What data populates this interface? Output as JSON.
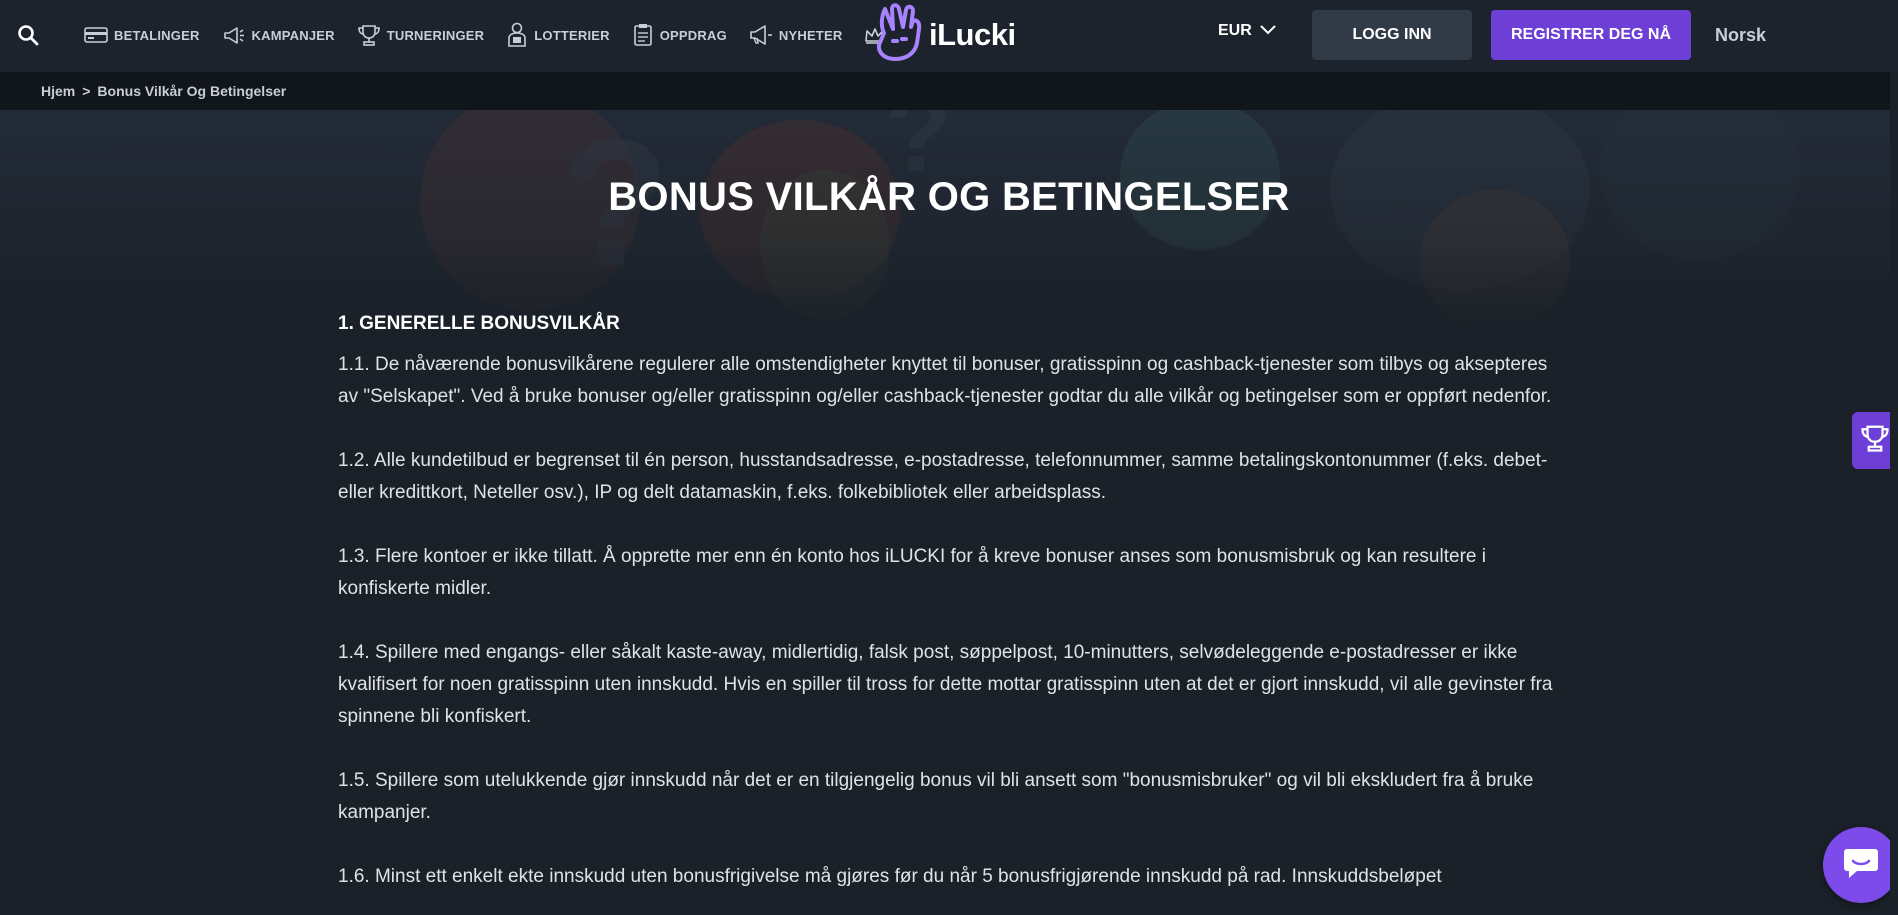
{
  "header": {
    "nav": [
      {
        "label": "BETALINGER",
        "icon": "card-icon"
      },
      {
        "label": "KAMPANJER",
        "icon": "megaphone-icon"
      },
      {
        "label": "TURNERINGER",
        "icon": "trophy-icon"
      },
      {
        "label": "LOTTERIER",
        "icon": "lottery-icon"
      },
      {
        "label": "OPPDRAG",
        "icon": "clipboard-icon"
      },
      {
        "label": "NYHETER",
        "icon": "news-megaphone-icon"
      }
    ],
    "vip_icon": "crown-icon",
    "logo_text": "iLucki",
    "currency": "EUR",
    "login_label": "LOGG INN",
    "register_label": "REGISTRER DEG NÅ",
    "language": "Norsk"
  },
  "breadcrumb": {
    "home": "Hjem",
    "separator": ">",
    "current": "Bonus Vilkår Og Betingelser"
  },
  "page": {
    "title": "BONUS VILKÅR OG BETINGELSER",
    "section_heading": "1. GENERELLE BONUSVILKÅR",
    "paragraphs": [
      "1.1. De nåværende bonusvilkårene regulerer alle omstendigheter knyttet til bonuser, gratisspinn og cashback-tjenester som tilbys og aksepteres av \"Selskapet\". Ved å bruke bonuser og/eller gratisspinn og/eller cashback-tjenester godtar du alle vilkår og betingelser som er oppført nedenfor.",
      "1.2. Alle kundetilbud er begrenset til én person, husstandsadresse, e-postadresse, telefonnummer, samme betalingskontonummer (f.eks. debet- eller kredittkort, Neteller osv.), IP og delt datamaskin, f.eks. folkebibliotek eller arbeidsplass.",
      "1.3. Flere kontoer er ikke tillatt. Å opprette mer enn én konto hos iLUCKI for å kreve bonuser anses som bonusmisbruk og kan resultere i konfiskerte midler.",
      "1.4. Spillere med engangs- eller såkalt kaste-away, midlertidig, falsk post, søppelpost, 10-minutters, selvødeleggende e-postadresser er ikke kvalifisert for noen gratisspinn uten innskudd. Hvis en spiller til tross for dette mottar gratisspinn uten at det er gjort innskudd, vil alle gevinster fra spinnene bli konfiskert.",
      "1.5. Spillere som utelukkende gjør innskudd når det er en tilgjengelig bonus vil bli ansett som \"bonusmisbruker\" og vil bli ekskludert fra å bruke kampanjer.",
      "1.6. Minst ett enkelt ekte innskudd uten bonusfrigivelse må gjøres før du når 5 bonusfrigjørende innskudd på rad. Innskuddsbeløpet"
    ]
  },
  "floating": {
    "trophy_icon": "trophy-icon",
    "chat_icon": "chat-icon"
  },
  "colors": {
    "accent": "#6d3fd6",
    "header_bg": "#1c232d",
    "page_bg": "#1b2129",
    "login_bg": "#313a47"
  }
}
